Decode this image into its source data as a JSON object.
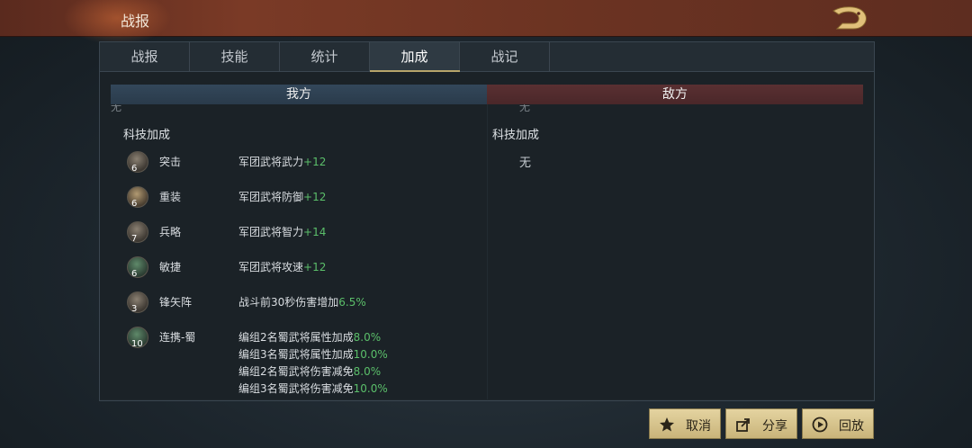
{
  "header": {
    "title": "战报"
  },
  "tabs": [
    {
      "label": "战报"
    },
    {
      "label": "技能"
    },
    {
      "label": "统计"
    },
    {
      "label": "加成"
    },
    {
      "label": "战记"
    }
  ],
  "active_tab": "加成",
  "columns": {
    "ours": "我方",
    "theirs": "敌方",
    "cut_text_left": "无",
    "cut_text_right": "无"
  },
  "ours": {
    "section_label": "科技加成",
    "items": [
      {
        "name": "突击",
        "level": "6",
        "effect": "军团武将武力",
        "value": "+12"
      },
      {
        "name": "重装",
        "level": "6",
        "effect": "军团武将防御",
        "value": "+12"
      },
      {
        "name": "兵略",
        "level": "7",
        "effect": "军团武将智力",
        "value": "+14"
      },
      {
        "name": "敏捷",
        "level": "6",
        "effect": "军团武将攻速",
        "value": "+12"
      },
      {
        "name": "锋矢阵",
        "level": "3",
        "effect": "战斗前30秒伤害增加",
        "value": "6.5%"
      },
      {
        "name": "连携-蜀",
        "level": "10",
        "lines": [
          {
            "text": "编组2名蜀武将属性加成",
            "value": "8.0%"
          },
          {
            "text": "编组3名蜀武将属性加成",
            "value": "10.0%"
          },
          {
            "text": "编组2名蜀武将伤害减免",
            "value": "8.0%"
          },
          {
            "text": "编组3名蜀武将伤害减免",
            "value": "10.0%"
          }
        ]
      }
    ]
  },
  "theirs": {
    "section_label": "科技加成",
    "none_text": "无"
  },
  "buttons": {
    "cancel": "取消",
    "share": "分享",
    "replay": "回放"
  },
  "colors": {
    "value_green": "#5bbf6a",
    "ours_header": "#2f4254",
    "theirs_header": "#52292b",
    "button_gold": "#d6c28a"
  }
}
